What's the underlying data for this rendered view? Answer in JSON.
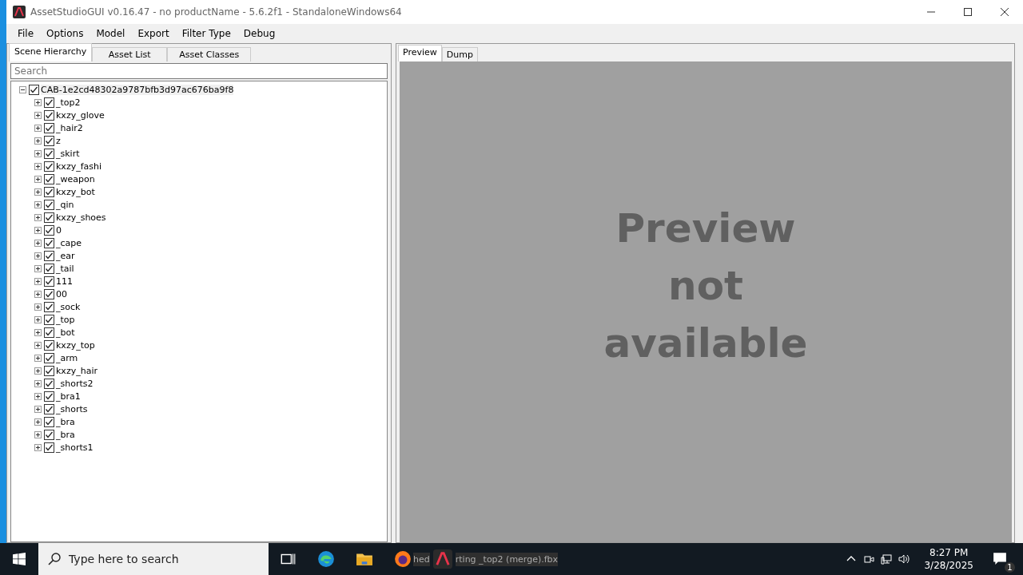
{
  "window": {
    "title": "AssetStudioGUI v0.16.47 - no productName - 5.6.2f1 - StandaloneWindows64"
  },
  "menu": [
    "File",
    "Options",
    "Model",
    "Export",
    "Filter Type",
    "Debug"
  ],
  "left_tabs": [
    {
      "label": "Scene Hierarchy",
      "selected": true
    },
    {
      "label": "Asset List",
      "selected": false
    },
    {
      "label": "Asset Classes",
      "selected": false
    }
  ],
  "search": {
    "placeholder": "Search"
  },
  "tree": [
    {
      "label": "CAB-1e2cd48302a9787bfb3d97ac676ba9f8",
      "checked": true,
      "expanded": true,
      "selected": true,
      "children": [
        {
          "label": "_top2",
          "checked": true,
          "expanded": false,
          "selected": false
        },
        {
          "label": "kxzy_glove",
          "checked": true,
          "expanded": false,
          "selected": false
        },
        {
          "label": "_hair2",
          "checked": true,
          "expanded": false,
          "selected": false
        },
        {
          "label": "z",
          "checked": true,
          "expanded": false,
          "selected": false
        },
        {
          "label": "_skirt",
          "checked": true,
          "expanded": false,
          "selected": false
        },
        {
          "label": "kxzy_fashi",
          "checked": true,
          "expanded": false,
          "selected": false
        },
        {
          "label": "_weapon",
          "checked": true,
          "expanded": false,
          "selected": false
        },
        {
          "label": "kxzy_bot",
          "checked": true,
          "expanded": false,
          "selected": false
        },
        {
          "label": "_qin",
          "checked": true,
          "expanded": false,
          "selected": false
        },
        {
          "label": "kxzy_shoes",
          "checked": true,
          "expanded": false,
          "selected": false
        },
        {
          "label": "0",
          "checked": true,
          "expanded": false,
          "selected": false
        },
        {
          "label": "_cape",
          "checked": true,
          "expanded": false,
          "selected": false
        },
        {
          "label": "_ear",
          "checked": true,
          "expanded": false,
          "selected": false
        },
        {
          "label": "_tail",
          "checked": true,
          "expanded": false,
          "selected": false
        },
        {
          "label": "111",
          "checked": true,
          "expanded": false,
          "selected": false
        },
        {
          "label": "00",
          "checked": true,
          "expanded": false,
          "selected": false
        },
        {
          "label": "_sock",
          "checked": true,
          "expanded": false,
          "selected": false
        },
        {
          "label": "_top",
          "checked": true,
          "expanded": false,
          "selected": false
        },
        {
          "label": "_bot",
          "checked": true,
          "expanded": false,
          "selected": false
        },
        {
          "label": "kxzy_top",
          "checked": true,
          "expanded": false,
          "selected": false
        },
        {
          "label": "_arm",
          "checked": true,
          "expanded": false,
          "selected": false
        },
        {
          "label": "kxzy_hair",
          "checked": true,
          "expanded": false,
          "selected": false
        },
        {
          "label": "_shorts2",
          "checked": true,
          "expanded": false,
          "selected": false
        },
        {
          "label": "_bra1",
          "checked": true,
          "expanded": false,
          "selected": false
        },
        {
          "label": "_shorts",
          "checked": true,
          "expanded": false,
          "selected": false
        },
        {
          "label": "_bra",
          "checked": true,
          "expanded": false,
          "selected": false
        },
        {
          "label": "_bra",
          "checked": true,
          "expanded": false,
          "selected": false
        },
        {
          "label": "_shorts1",
          "checked": true,
          "expanded": false,
          "selected": false
        }
      ]
    }
  ],
  "right_tabs": [
    {
      "label": "Preview",
      "selected": true
    },
    {
      "label": "Dump",
      "selected": false
    }
  ],
  "preview": {
    "message": "Preview not available"
  },
  "status_fragments": [
    "hed",
    "rting _top2 (merge).fbx"
  ],
  "taskbar": {
    "search_placeholder": "Type here to search",
    "time": "8:27 PM",
    "date": "3/28/2025",
    "notifications": "1"
  }
}
